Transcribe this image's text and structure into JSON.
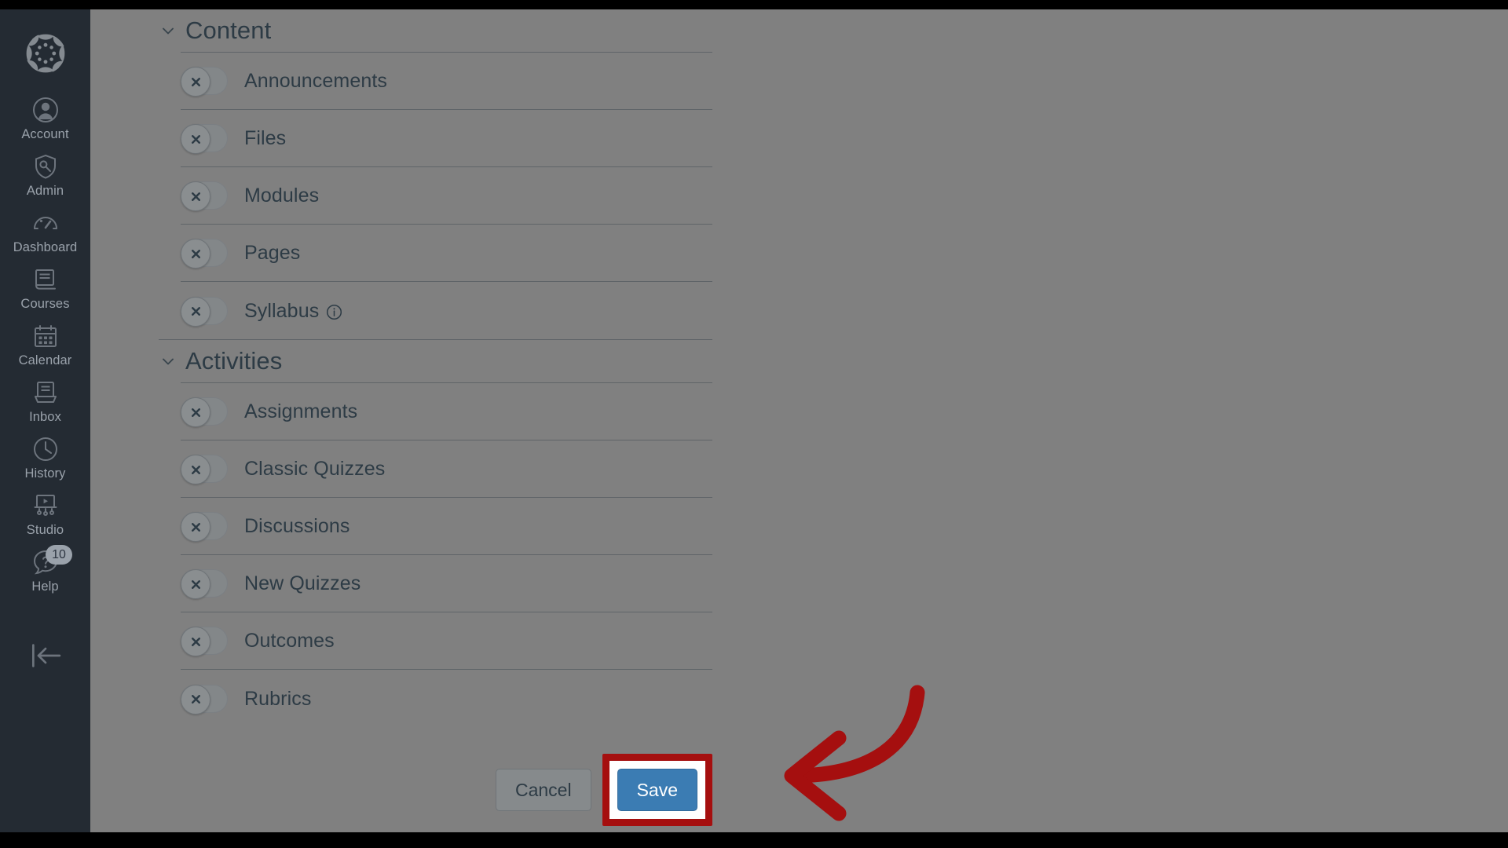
{
  "global_nav": {
    "logo_name": "Canvas",
    "items": [
      {
        "label": "Account",
        "icon": "user-avatar-icon"
      },
      {
        "label": "Admin",
        "icon": "shield-wrench-icon"
      },
      {
        "label": "Dashboard",
        "icon": "gauge-icon"
      },
      {
        "label": "Courses",
        "icon": "book-icon"
      },
      {
        "label": "Calendar",
        "icon": "calendar-icon"
      },
      {
        "label": "Inbox",
        "icon": "inbox-tray-icon"
      },
      {
        "label": "History",
        "icon": "clock-icon"
      },
      {
        "label": "Studio",
        "icon": "studio-screen-icon"
      },
      {
        "label": "Help",
        "icon": "question-bubble-icon",
        "badge": "10"
      }
    ],
    "collapse_label": "Collapse navigation",
    "collapse_icon": "collapse-left-icon"
  },
  "sections": [
    {
      "title": "Content",
      "chevron_icon": "chevron-down-icon",
      "items": [
        {
          "label": "Announcements",
          "state": "off",
          "toggle_icon": "x-icon"
        },
        {
          "label": "Files",
          "state": "off",
          "toggle_icon": "x-icon"
        },
        {
          "label": "Modules",
          "state": "off",
          "toggle_icon": "x-icon"
        },
        {
          "label": "Pages",
          "state": "off",
          "toggle_icon": "x-icon"
        },
        {
          "label": "Syllabus",
          "state": "off",
          "toggle_icon": "x-icon",
          "info_icon": "info-circle-icon"
        }
      ]
    },
    {
      "title": "Activities",
      "chevron_icon": "chevron-down-icon",
      "items": [
        {
          "label": "Assignments",
          "state": "off",
          "toggle_icon": "x-icon"
        },
        {
          "label": "Classic Quizzes",
          "state": "off",
          "toggle_icon": "x-icon"
        },
        {
          "label": "Discussions",
          "state": "off",
          "toggle_icon": "x-icon"
        },
        {
          "label": "New Quizzes",
          "state": "off",
          "toggle_icon": "x-icon"
        },
        {
          "label": "Outcomes",
          "state": "off",
          "toggle_icon": "x-icon"
        },
        {
          "label": "Rubrics",
          "state": "off",
          "toggle_icon": "x-icon"
        }
      ]
    }
  ],
  "footer": {
    "cancel_label": "Cancel",
    "save_label": "Save"
  },
  "annotation": {
    "highlight_target": "save-button",
    "arrow_icon": "curved-arrow-left-icon",
    "color": "#A50F0F"
  },
  "colors": {
    "nav_background": "#242B33",
    "overlay": "#808080",
    "primary_button": "#3B7CB3",
    "text": "#2D3B45",
    "annotation_red": "#A50F0F"
  }
}
